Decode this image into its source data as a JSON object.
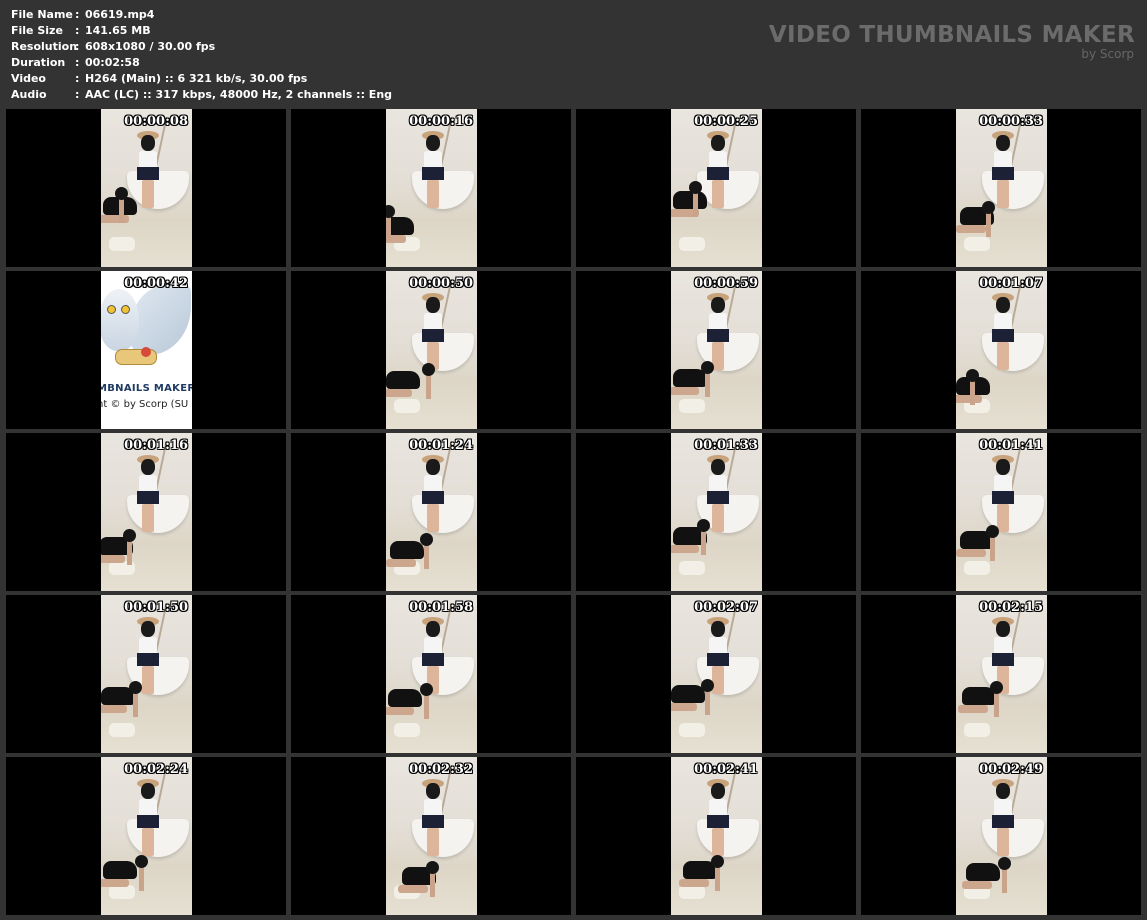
{
  "info": {
    "rows": [
      {
        "key": "File Name",
        "sep": ":",
        "value": "06619.mp4"
      },
      {
        "key": "File Size",
        "sep": ":",
        "value": "141.65 MB"
      },
      {
        "key": "Resolution",
        "sep": ":",
        "value": "608x1080 / 30.00 fps"
      },
      {
        "key": "Duration",
        "sep": ":",
        "value": "00:02:58"
      },
      {
        "key": "Video",
        "sep": ":",
        "value": "H264 (Main) :: 6 321 kb/s, 30.00 fps"
      },
      {
        "key": "Audio",
        "sep": ":",
        "value": "AAC (LC) :: 317 kbps, 48000 Hz, 2 channels :: Eng"
      }
    ]
  },
  "branding": {
    "title": "VIDEO THUMBNAILS MAKER",
    "byline": "by Scorp"
  },
  "thumbnails": [
    {
      "time": "00:00:08"
    },
    {
      "time": "00:00:16"
    },
    {
      "time": "00:00:25"
    },
    {
      "time": "00:00:33"
    },
    {
      "time": "00:00:42",
      "logo_text_1": "MBNAILS MAKER 8",
      "logo_text_2": "nt © by Scorp (SU"
    },
    {
      "time": "00:00:50"
    },
    {
      "time": "00:00:59"
    },
    {
      "time": "00:01:07"
    },
    {
      "time": "00:01:16"
    },
    {
      "time": "00:01:24"
    },
    {
      "time": "00:01:33"
    },
    {
      "time": "00:01:41"
    },
    {
      "time": "00:01:50"
    },
    {
      "time": "00:01:58"
    },
    {
      "time": "00:02:07"
    },
    {
      "time": "00:02:15"
    },
    {
      "time": "00:02:24"
    },
    {
      "time": "00:02:32"
    },
    {
      "time": "00:02:41"
    },
    {
      "time": "00:02:49"
    }
  ],
  "colors": {
    "background": "#333333",
    "cell": "#000000",
    "text": "#ffffff",
    "logo": "#6b6b6b"
  }
}
